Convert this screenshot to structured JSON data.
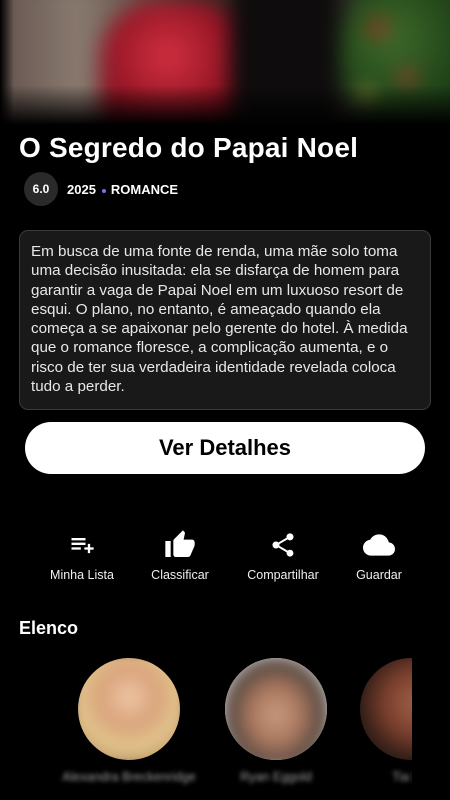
{
  "movie": {
    "title": "O Segredo do Papai Noel",
    "rating": "6.0",
    "year": "2025",
    "genre": "ROMANCE",
    "synopsis": "Em busca de uma fonte de renda, uma mãe solo toma uma decisão inusitada: ela se disfarça de homem para garantir a vaga de Papai Noel em um luxuoso resort de esqui. O plano, no entanto, é ameaçado quando ela começa a se apaixonar pelo gerente do hotel. À medida que o romance floresce, a complicação aumenta, e o risco de ter sua verdadeira identidade revelada coloca tudo a perder."
  },
  "details_button": {
    "label": "Ver Detalhes"
  },
  "actions": [
    {
      "label": "Minha Lista",
      "icon": "playlist-add-icon"
    },
    {
      "label": "Classificar",
      "icon": "thumbs-up-icon"
    },
    {
      "label": "Compartilhar",
      "icon": "share-icon"
    },
    {
      "label": "Guardar",
      "icon": "cloud-icon"
    }
  ],
  "cast": {
    "heading": "Elenco",
    "members": [
      {
        "name": "Alexandra Breckenridge"
      },
      {
        "name": "Ryan Eggold"
      },
      {
        "name": "Tia Mo"
      }
    ]
  },
  "colors": {
    "background": "#000000",
    "accent_dot": "#7b6ff0",
    "button_bg": "#ffffff",
    "card_bg": "#191919"
  }
}
